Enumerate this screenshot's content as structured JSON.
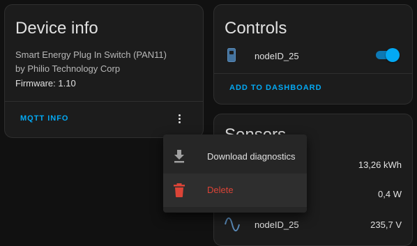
{
  "device_card": {
    "title": "Device info",
    "model_line1": "Smart Energy Plug In Switch (PAN11)",
    "model_line2": "by Philio Technology Corp",
    "firmware": "Firmware: 1.10",
    "mqtt_button": "MQTT INFO",
    "menu_icon": "dots-vertical-icon"
  },
  "controls_card": {
    "title": "Controls",
    "rows": [
      {
        "icon": "plug-switch-icon",
        "label": "nodeID_25",
        "state": "on"
      }
    ],
    "dashboard_button": "ADD TO DASHBOARD"
  },
  "sensors_card": {
    "title": "Sensors",
    "rows": [
      {
        "icon": "",
        "label": "",
        "value": "13,26 kWh"
      },
      {
        "icon": "",
        "label": "",
        "value": "0,4 W"
      },
      {
        "icon": "sine-wave-icon",
        "label": "nodeID_25",
        "value": "235,7 V"
      }
    ]
  },
  "context_menu": {
    "items": [
      {
        "label": "Download diagnostics",
        "icon": "download-icon"
      },
      {
        "label": "Delete",
        "icon": "trash-icon"
      }
    ]
  },
  "colors": {
    "accent": "#03a9f4",
    "danger": "#db4437",
    "card_bg": "#1c1c1c",
    "page_bg": "#111111"
  }
}
